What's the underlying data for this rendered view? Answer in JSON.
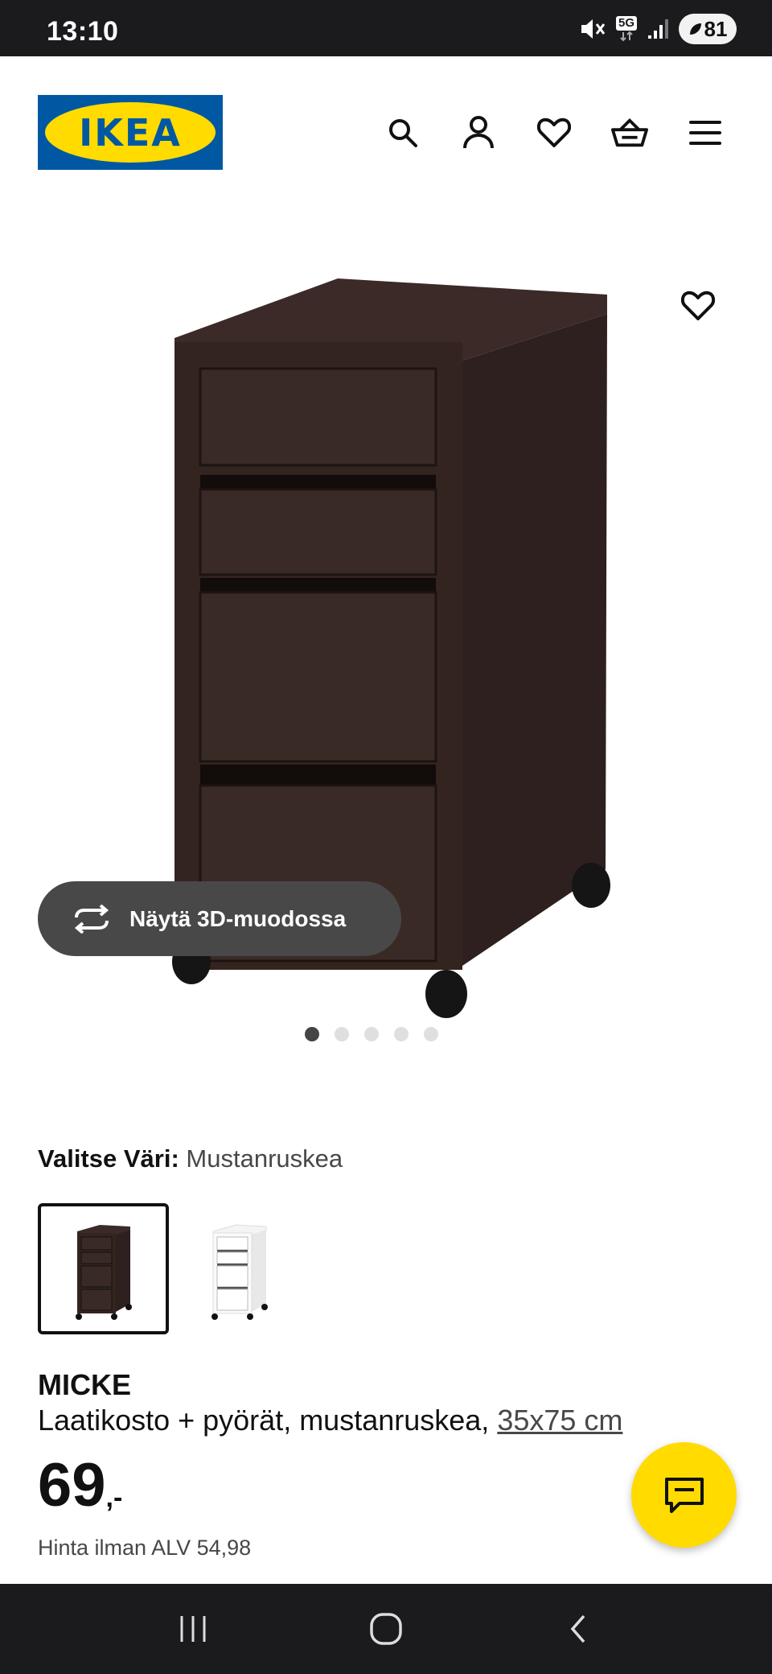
{
  "status_bar": {
    "time": "13:10",
    "network": "5G",
    "battery": "81"
  },
  "header": {
    "logo_text": "IKEA",
    "icons": [
      "search-icon",
      "account-icon",
      "heart-icon",
      "basket-icon",
      "menu-icon"
    ]
  },
  "gallery": {
    "view_3d_label": "Näytä 3D-muodossa",
    "dot_count": 5,
    "active_dot": 0
  },
  "color_selector": {
    "label": "Valitse Väri:",
    "value": "Mustanruskea",
    "options": [
      "Mustanruskea",
      "Valkoinen"
    ]
  },
  "product": {
    "name": "MICKE",
    "description": "Laatikosto + pyörät, mustanruskea, ",
    "size": "35x75 cm",
    "price_integer": "69",
    "price_suffix": ",-",
    "price_vat": "Hinta ilman ALV 54,98"
  },
  "colors": {
    "ikea_blue": "#0058a3",
    "ikea_yellow": "#ffdb00",
    "product_brown": "#3a2a28"
  }
}
